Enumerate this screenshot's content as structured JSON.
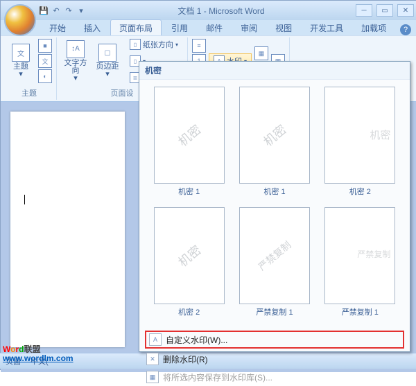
{
  "title": "文档 1 - Microsoft Word",
  "tabs": {
    "home": "开始",
    "insert": "插入",
    "layout": "页面布局",
    "ref": "引用",
    "mail": "邮件",
    "review": "审阅",
    "view": "视图",
    "dev": "开发工具",
    "addin": "加载项"
  },
  "groups": {
    "theme": {
      "btn": "主题",
      "label": "主题"
    },
    "textdir": {
      "btn": "文字方向",
      "label": ""
    },
    "margin": {
      "btn": "页边距",
      "label": "页面设"
    },
    "orient": {
      "btn": "纸张方向"
    },
    "watermark": {
      "btn": "水印"
    }
  },
  "dropdown": {
    "header": "机密",
    "items": [
      {
        "wm": "机密",
        "label": "机密 1",
        "style": "diag"
      },
      {
        "wm": "机密",
        "label": "机密 1",
        "style": "diag"
      },
      {
        "wm": "机密",
        "label": "机密 2",
        "style": "corner"
      },
      {
        "wm": "机密",
        "label": "机密 2",
        "style": "diag"
      },
      {
        "wm": "严禁复制",
        "label": "严禁复制 1",
        "style": "diag"
      },
      {
        "wm": "严禁复制",
        "label": "严禁复制 1",
        "style": "corner"
      }
    ],
    "custom": "自定义水印(W)...",
    "remove": "删除水印(R)",
    "save": "将所选内容保存到水印库(S)..."
  },
  "status": {
    "page": "页面",
    "lang": "中文("
  },
  "logo": {
    "l1a": "W",
    "l1b": "o",
    "l1c": "r",
    "l1d": "d",
    "l1rest": "联盟",
    "l2": "www.wordlm.com"
  }
}
